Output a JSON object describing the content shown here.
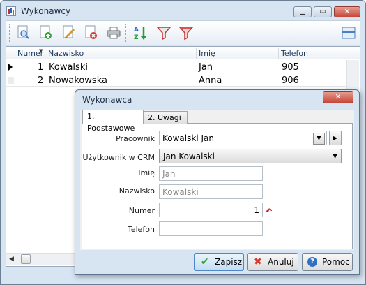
{
  "window": {
    "title": "Wykonawcy"
  },
  "grid": {
    "columns": [
      "Numer",
      "Nazwisko",
      "Imię",
      "Telefon"
    ],
    "rows": [
      {
        "numer": "1",
        "nazwisko": "Kowalski",
        "imie": "Jan",
        "telefon": "905"
      },
      {
        "numer": "2",
        "nazwisko": "Nowakowska",
        "imie": "Anna",
        "telefon": "906"
      }
    ]
  },
  "dialog": {
    "title": "Wykonawca",
    "tabs": [
      "1. Podstawowe",
      "2. Uwagi"
    ],
    "fields": {
      "pracownik": {
        "label": "Pracownik",
        "value": "Kowalski Jan"
      },
      "uzytkownik": {
        "label": "Użytkownik w CRM",
        "value": "Jan Kowalski"
      },
      "imie": {
        "label": "Imię",
        "value": "Jan"
      },
      "nazwisko": {
        "label": "Nazwisko",
        "value": "Kowalski"
      },
      "numer": {
        "label": "Numer",
        "value": "1"
      },
      "telefon": {
        "label": "Telefon",
        "value": ""
      }
    },
    "buttons": {
      "save": "Zapisz",
      "cancel": "Anuluj",
      "help": "Pomoc"
    }
  },
  "colors": {
    "accent": "#4e88c8",
    "window_frame": "#d7e4f2",
    "filter_red": "#c63030"
  }
}
